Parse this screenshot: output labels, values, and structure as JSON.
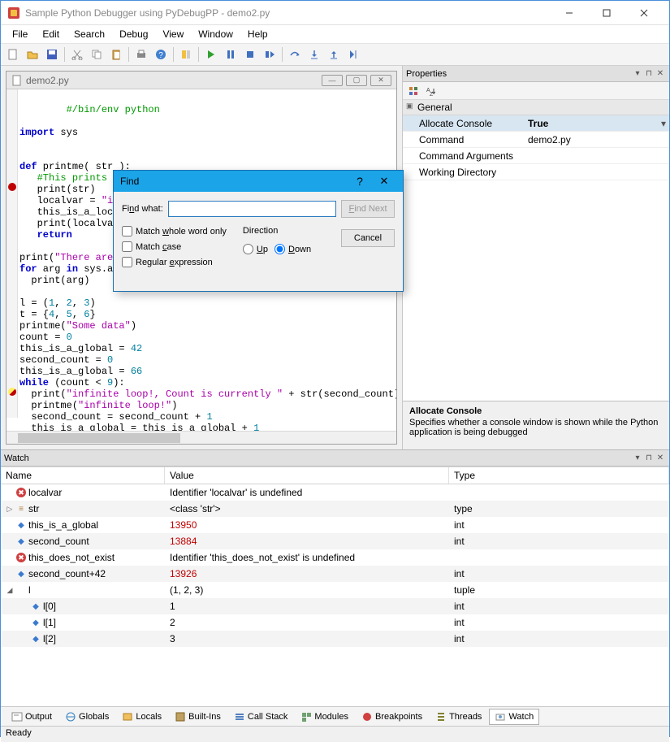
{
  "titlebar": {
    "title": "Sample Python Debugger using PyDebugPP - demo2.py"
  },
  "menubar": {
    "items": [
      "File",
      "Edit",
      "Search",
      "Debug",
      "View",
      "Window",
      "Help"
    ]
  },
  "editor": {
    "filename": "demo2.py"
  },
  "code": {
    "l1": "#/bin/env python",
    "l3a": "import",
    "l3b": " sys",
    "l6a": "def",
    "l6b": " printme",
    "l6c": "( str ):",
    "l7": "#This prints a passed string into this function",
    "l8a": "print",
    "l8b": "(str)",
    "l9a": "localvar = ",
    "l9b": "\"in Pr",
    "l10a": "this_is_a_local =",
    "l11a": "print",
    "l11b": "(localvar)",
    "l12": "return",
    "l14a": "print",
    "l14b": "(",
    "l14c": "\"There are\"",
    "l14d": ",",
    "l15a": "for",
    "l15b": " arg ",
    "l15c": "in",
    "l15d": " sys.arg",
    "l16a": "print",
    "l16b": "(arg)",
    "l18a": "l = (",
    "l18b": "1",
    "l18c": ", ",
    "l18d": "2",
    "l18e": ", ",
    "l18f": "3",
    "l18g": ")",
    "l19a": "t = {",
    "l19b": "4",
    "l19c": ", ",
    "l19d": "5",
    "l19e": ", ",
    "l19f": "6",
    "l19g": "}",
    "l20a": "printme(",
    "l20b": "\"Some data\"",
    "l20c": ")",
    "l21a": "count = ",
    "l21b": "0",
    "l22a": "this_is_a_global = ",
    "l22b": "42",
    "l23a": "second_count = ",
    "l23b": "0",
    "l24a": "this_is_a_global = ",
    "l24b": "66",
    "l25a": "while",
    "l25b": " (count < ",
    "l25c": "9",
    "l25d": "):",
    "l26a": "print",
    "l26b": "(",
    "l26c": "\"infinite loop!, Count is currently \"",
    "l26d": " + str(second_count))",
    "l27a": "printme(",
    "l27b": "\"infinite loop!\"",
    "l27c": ")",
    "l28a": "second_count = second_count + ",
    "l28b": "1",
    "l29a": "this_is_a_global = this_is_a_global + ",
    "l29b": "1"
  },
  "properties": {
    "title": "Properties",
    "category": "General",
    "rows": [
      {
        "k": "Allocate Console",
        "v": "True"
      },
      {
        "k": "Command",
        "v": "demo2.py"
      },
      {
        "k": "Command Arguments",
        "v": ""
      },
      {
        "k": "Working Directory",
        "v": ""
      }
    ],
    "help_title": "Allocate Console",
    "help_text": "Specifies whether a console window is shown while the Python application is being debugged"
  },
  "watch": {
    "title": "Watch",
    "cols": {
      "name": "Name",
      "value": "Value",
      "type": "Type"
    },
    "rows": [
      {
        "icon": "err",
        "exp": "",
        "name": "localvar",
        "value": "Identifier 'localvar' is undefined",
        "type": "",
        "red": false
      },
      {
        "icon": "str",
        "exp": "▷",
        "name": "str",
        "value": "<class 'str'>",
        "type": "type",
        "red": false
      },
      {
        "icon": "blue",
        "exp": "",
        "name": "this_is_a_global",
        "value": "13950",
        "type": "int",
        "red": true
      },
      {
        "icon": "blue",
        "exp": "",
        "name": "second_count",
        "value": "13884",
        "type": "int",
        "red": true
      },
      {
        "icon": "err",
        "exp": "",
        "name": "this_does_not_exist",
        "value": "Identifier 'this_does_not_exist' is undefined",
        "type": "",
        "red": false
      },
      {
        "icon": "blue",
        "exp": "",
        "name": "second_count+42",
        "value": "13926",
        "type": "int",
        "red": true
      },
      {
        "icon": "",
        "exp": "◢",
        "name": "l",
        "value": "(1, 2, 3)",
        "type": "tuple",
        "red": false
      },
      {
        "icon": "blue",
        "exp": "",
        "name": "l[0]",
        "value": "1",
        "type": "int",
        "red": false,
        "indent": 1
      },
      {
        "icon": "blue",
        "exp": "",
        "name": "l[1]",
        "value": "2",
        "type": "int",
        "red": false,
        "indent": 1
      },
      {
        "icon": "blue",
        "exp": "",
        "name": "l[2]",
        "value": "3",
        "type": "int",
        "red": false,
        "indent": 1
      }
    ]
  },
  "bottom_tabs": {
    "items": [
      "Output",
      "Globals",
      "Locals",
      "Built-Ins",
      "Call Stack",
      "Modules",
      "Breakpoints",
      "Threads",
      "Watch"
    ],
    "active": "Watch"
  },
  "statusbar": {
    "text": "Ready"
  },
  "find": {
    "title": "Find",
    "label": "Find what:",
    "value": "",
    "find_next": "Find Next",
    "cancel": "Cancel",
    "opt_whole": "Match whole word only",
    "opt_case": "Match case",
    "opt_regex": "Regular expression",
    "direction": "Direction",
    "up": "Up",
    "down": "Down"
  }
}
